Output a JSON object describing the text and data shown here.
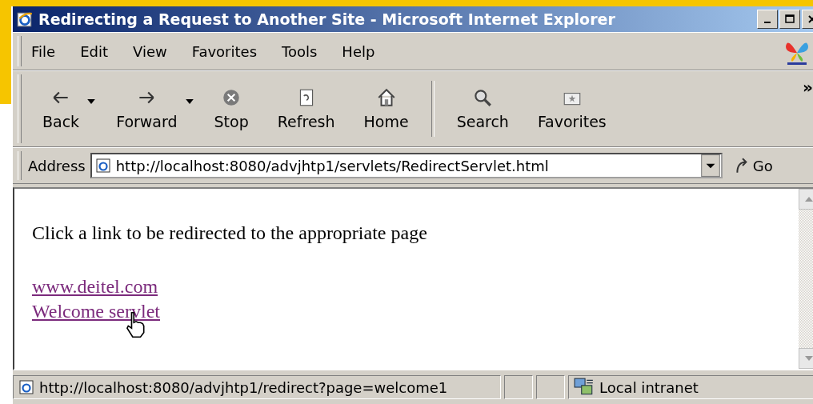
{
  "window": {
    "title": "Redirecting a Request to Another Site - Microsoft Internet Explorer"
  },
  "menu": [
    "File",
    "Edit",
    "View",
    "Favorites",
    "Tools",
    "Help"
  ],
  "toolbar": {
    "groups": [
      [
        {
          "label": "Back",
          "has_menu": true
        },
        {
          "label": "Forward",
          "has_menu": true
        },
        {
          "label": "Stop",
          "has_menu": false
        },
        {
          "label": "Refresh",
          "has_menu": false
        },
        {
          "label": "Home",
          "has_menu": false
        }
      ],
      [
        {
          "label": "Search",
          "has_menu": false
        },
        {
          "label": "Favorites",
          "has_menu": false
        }
      ]
    ],
    "overflow": "»"
  },
  "address": {
    "label": "Address",
    "value": "http://localhost:8080/advjhtp1/servlets/RedirectServlet.html",
    "go": "Go"
  },
  "content": {
    "intro": "Click a link to be redirected to the appropriate page",
    "links": [
      "www.deitel.com",
      "Welcome servlet"
    ]
  },
  "status_bar": {
    "text": "http://localhost:8080/advjhtp1/redirect?page=welcome1",
    "zone": "Local intranet"
  }
}
